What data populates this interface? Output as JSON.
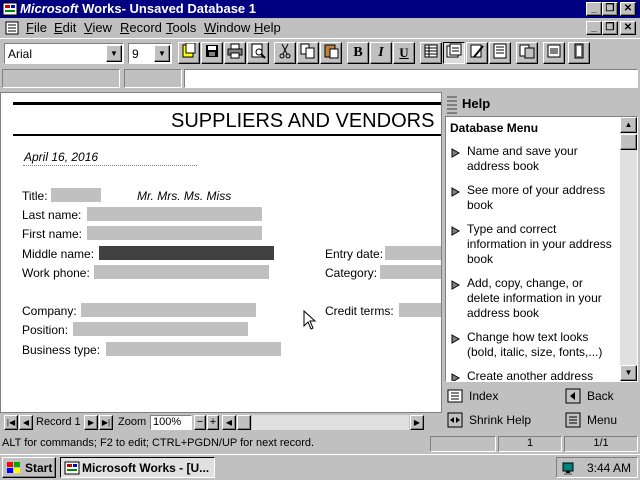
{
  "window": {
    "title_brand": "Microsoft",
    "title_rest": " Works- Unsaved Database 1",
    "minimize": "_",
    "restore": "❐",
    "close": "✕"
  },
  "menu": {
    "items": [
      {
        "label": "File",
        "key": "F"
      },
      {
        "label": "Edit",
        "key": "E"
      },
      {
        "label": "View",
        "key": "V"
      },
      {
        "label": "Record",
        "key": "R"
      },
      {
        "label": "Tools",
        "key": "T"
      },
      {
        "label": "Window",
        "key": "W"
      },
      {
        "label": "Help",
        "key": "H"
      }
    ]
  },
  "toolbar": {
    "font_name": "Arial",
    "font_size": "9",
    "bold": "B",
    "italic": "I",
    "underline": "U"
  },
  "form": {
    "title": "SUPPLIERS AND VENDORS",
    "date": "April 16, 2016",
    "title_label": "Title:",
    "title_options": "Mr. Mrs. Ms. Miss",
    "last_name": "Last name:",
    "first_name": "First name:",
    "middle_name": "Middle name:",
    "work_phone": "Work phone:",
    "entry_date": "Entry date:",
    "category": "Category:",
    "company": "Company:",
    "position": "Position:",
    "business_type": "Business type:",
    "credit_terms": "Credit terms:"
  },
  "nav": {
    "record": "Record 1",
    "zoom_label": "Zoom",
    "zoom_value": "100%"
  },
  "help": {
    "title": "Help",
    "menu_title": "Database Menu",
    "items": [
      "Name and save your address book",
      "See more of your address book",
      "Type and correct information in your address book",
      "Add, copy, change, or delete information in your address book",
      "Change how text looks (bold, italic, size, fonts,...)",
      "Create another address"
    ],
    "index": "Index",
    "back": "Back",
    "shrink": "Shrink Help",
    "menu": "Menu"
  },
  "status": {
    "message": "ALT for commands; F2 to edit; CTRL+PGDN/UP for next record.",
    "record_num": "1",
    "record_count": "1/1"
  },
  "taskbar": {
    "start": "Start",
    "task": "Microsoft Works - [U...",
    "time": "3:44 AM"
  }
}
